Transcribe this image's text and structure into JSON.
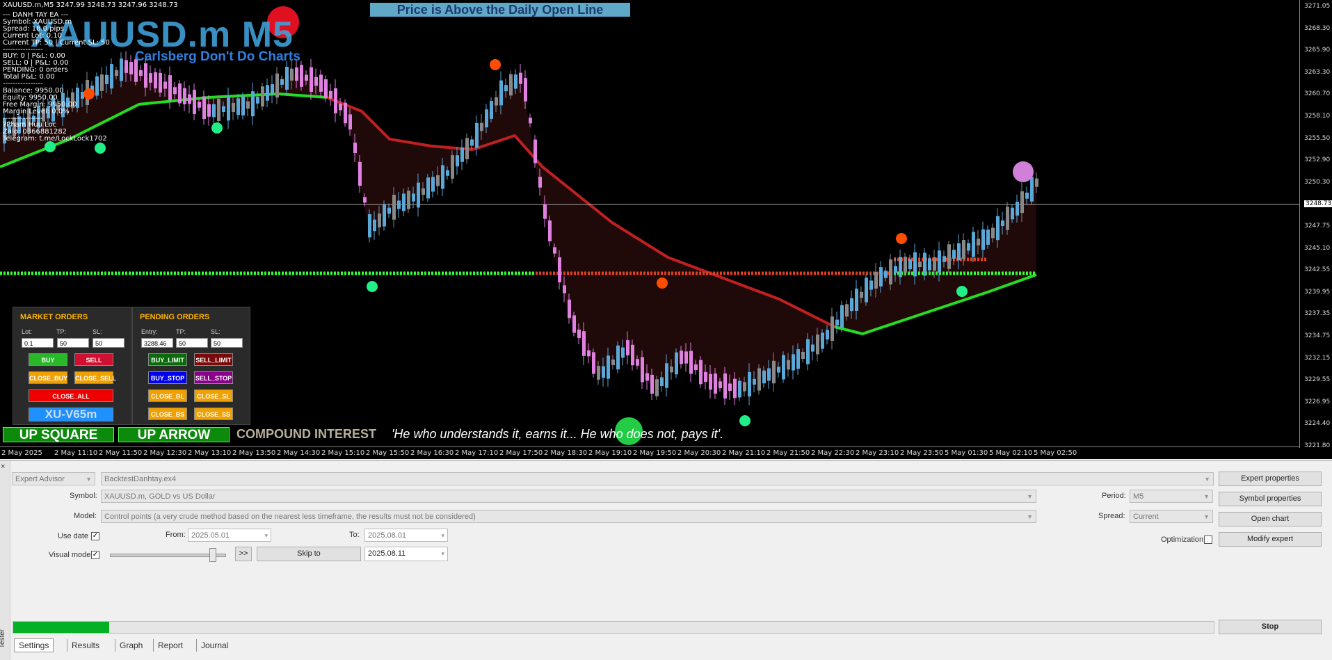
{
  "chart": {
    "header": "XAUUSD.m,M5  3247.99 3248.73 3247.96 3248.73",
    "symbol_big": "XAUUSD.m M5",
    "subtitle": "Carlsberg Don't Do Charts",
    "banner": "Price is Above the Daily Open Line",
    "info_lines": [
      "--- DANH TAY EA ---",
      "Symbol: XAUUSD.m",
      "Spread: 18.0 pips",
      "Current Lot: 0.10",
      "Current TP: 50 | Current SL: 50",
      "----------------",
      "BUY: 0 | P&L: 0.00",
      "SELL: 0 | P&L: 0.00",
      "PENDING: 0 orders",
      "Total P&L: 0.00",
      "----------------",
      "Balance: 9950.00",
      "Equity: 9950.00",
      "Free Margin: 9950.00",
      "Margin Level: 0.0%",
      "----------------",
      "?Pham Huu Loc",
      "Zalo: 0366881282",
      "Telegram: t.me/LockLock1702"
    ],
    "price_labels": [
      "3271.05",
      "3268.30",
      "3265.90",
      "3263.30",
      "3260.70",
      "3258.10",
      "3255.50",
      "3252.90",
      "3250.30",
      "3248.73",
      "3247.75",
      "3245.10",
      "3242.55",
      "3239.95",
      "3237.35",
      "3234.75",
      "3232.15",
      "3229.55",
      "3226.95",
      "3224.40",
      "3221.80"
    ],
    "current_price": "3248.73",
    "time_labels": [
      "2 May 2025",
      "2 May 11:10",
      "2 May 11:50",
      "2 May 12:30",
      "2 May 13:10",
      "2 May 13:50",
      "2 May 14:30",
      "2 May 15:10",
      "2 May 15:50",
      "2 May 16:30",
      "2 May 17:10",
      "2 May 17:50",
      "2 May 18:30",
      "2 May 19:10",
      "2 May 19:50",
      "2 May 20:30",
      "2 May 21:10",
      "2 May 21:50",
      "2 May 22:30",
      "2 May 23:10",
      "2 May 23:50",
      "5 May 01:30",
      "5 May 02:10",
      "5 May 02:50"
    ],
    "up_square": "UP SQUARE",
    "up_arrow": "UP ARROW",
    "compound": "COMPOUND INTEREST",
    "quote": "'He who understands it, earns it... He who does not, pays it'.",
    "colors": {
      "bull": "#5aa8d8",
      "bear": "#e080e0",
      "up_line": "#22cc22",
      "down_line": "#c02020"
    }
  },
  "market_orders": {
    "title": "MARKET ORDERS",
    "lot_label": "Lot:",
    "tp_label": "TP:",
    "sl_label": "SL:",
    "lot": "0.1",
    "tp": "50",
    "sl": "50",
    "buy": "BUY",
    "sell": "SELL",
    "close_buy": "CLOSE_BUY",
    "close_sell": "CLOSE_SELL",
    "close_all": "CLOSE_ALL",
    "server": "XU-V65m"
  },
  "pending_orders": {
    "title": "PENDING ORDERS",
    "entry_label": "Entry:",
    "tp_label": "TP:",
    "sl_label": "SL:",
    "entry": "3288.46",
    "tp": "50",
    "sl": "50",
    "buy_limit": "BUY_LIMIT",
    "sell_limit": "SELL_LIMIT",
    "buy_stop": "BUY_STOP",
    "sell_stop": "SELL_STOP",
    "close_bl": "CLOSE_BL",
    "close_sl": "CLOSE_SL",
    "close_bs": "CLOSE_BS",
    "close_ss": "CLOSE_SS"
  },
  "tester": {
    "side_label": "Tester",
    "type": "Expert Advisor",
    "expert": "BacktestDanhtay.ex4",
    "symbol_label": "Symbol:",
    "symbol": "XAUUSD.m, GOLD vs US Dollar",
    "model_label": "Model:",
    "model": "Control points (a very crude method based on the nearest less timeframe, the results must not be considered)",
    "use_date": "Use date",
    "from_label": "From:",
    "from": "2025.05.01",
    "to_label": "To:",
    "to": "2025.08.01",
    "visual_mode": "Visual mode",
    "ff": ">>",
    "skip_to": "Skip to",
    "skip_date": "2025.08.11",
    "period_label": "Period:",
    "period": "M5",
    "spread_label": "Spread:",
    "spread": "Current",
    "optimization": "Optimization",
    "btn_expert_props": "Expert properties",
    "btn_symbol_props": "Symbol properties",
    "btn_open_chart": "Open chart",
    "btn_modify": "Modify expert",
    "btn_stop": "Stop",
    "progress": 0.08,
    "tabs": [
      "Settings",
      "Results",
      "Graph",
      "Report",
      "Journal"
    ]
  }
}
